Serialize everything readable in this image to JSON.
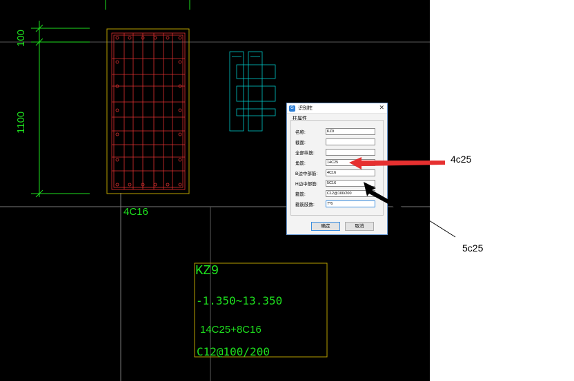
{
  "drawing": {
    "dim_top": "100",
    "dim_main": "1100",
    "rebar_label": "4C16",
    "kz_title": "KZ9",
    "kz_elev": "-1.350~13.350",
    "kz_long_rebar": "14C25+8C16",
    "kz_stirrup": "C12@100/200"
  },
  "dialog": {
    "title": "识别柱",
    "group_label": "柱属性",
    "fields": [
      {
        "label": "名称:",
        "value": ""
      },
      {
        "label": "截面:",
        "value": ""
      },
      {
        "label": "全部纵筋:",
        "value": ""
      },
      {
        "label": "角筋:",
        "value": "14C25"
      },
      {
        "label": "B边中部筋:",
        "value": "4C16"
      },
      {
        "label": "H边中部筋:",
        "value": "5C16"
      },
      {
        "label": "箍筋:",
        "value": "C12@100/200"
      },
      {
        "label": "箍筋肢数:",
        "value": "7*6"
      }
    ],
    "name_value": "KZ9",
    "ok_label": "确定",
    "cancel_label": "取消",
    "close_symbol": "✕"
  },
  "annotations": {
    "red_note": "4c25",
    "black_note": "5c25"
  },
  "colors": {
    "cad_bg": "#000000",
    "dim_green": "#1ee01e",
    "column_red": "#e03030",
    "frame_yellow": "#b8a000",
    "cyan": "#00c8c8",
    "arrow_red": "#e63030"
  }
}
